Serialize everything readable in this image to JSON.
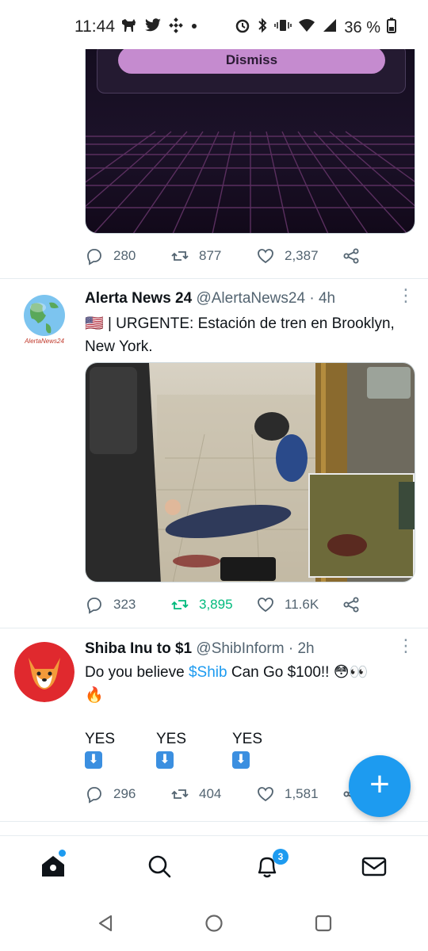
{
  "status_bar": {
    "time": "11:44",
    "battery": "36 %",
    "icons_left": [
      "dog-icon",
      "twitter-icon",
      "binance-icon",
      "dot-icon"
    ],
    "icons_right": [
      "alarm-icon",
      "bluetooth-icon",
      "vibrate-icon",
      "wifi-icon",
      "signal-icon",
      "battery-icon"
    ]
  },
  "top_card": {
    "dismiss_label": "Dismiss",
    "stats": {
      "replies": "280",
      "retweets": "877",
      "likes": "2,387"
    }
  },
  "tweets": [
    {
      "name": "Alerta News 24",
      "handle": "@AlertaNews24",
      "sep": "·",
      "time": "4h",
      "avatar_label": "AlertaNews24",
      "flag": "🇺🇸",
      "text": "| URGENTE: Estación de tren en Brooklyn, New York.",
      "stats": {
        "replies": "323",
        "retweets": "3,895",
        "likes": "11.6K"
      }
    },
    {
      "name": "Shiba Inu to $1",
      "handle": "@ShibInform",
      "sep": "·",
      "time": "2h",
      "text_prefix": "Do you believe ",
      "cashtag": "$Shib",
      "text_suffix": " Can Go $100!! 😳👀",
      "fire": "🔥",
      "poll": [
        "YES",
        "YES",
        "YES"
      ],
      "stats": {
        "replies": "296",
        "retweets": "404",
        "likes": "1,581"
      }
    }
  ],
  "fab": {
    "label": "+",
    "icon": "compose-plus-icon"
  },
  "bottom_nav": {
    "items": [
      "home-icon",
      "search-icon",
      "notifications-icon",
      "messages-icon"
    ],
    "notifications_badge": "3"
  },
  "system_nav": [
    "back-icon",
    "home-circle-icon",
    "recents-icon"
  ],
  "colors": {
    "accent": "#1d9bf0",
    "retweet_active": "#00ba7c",
    "muted": "#536471"
  }
}
